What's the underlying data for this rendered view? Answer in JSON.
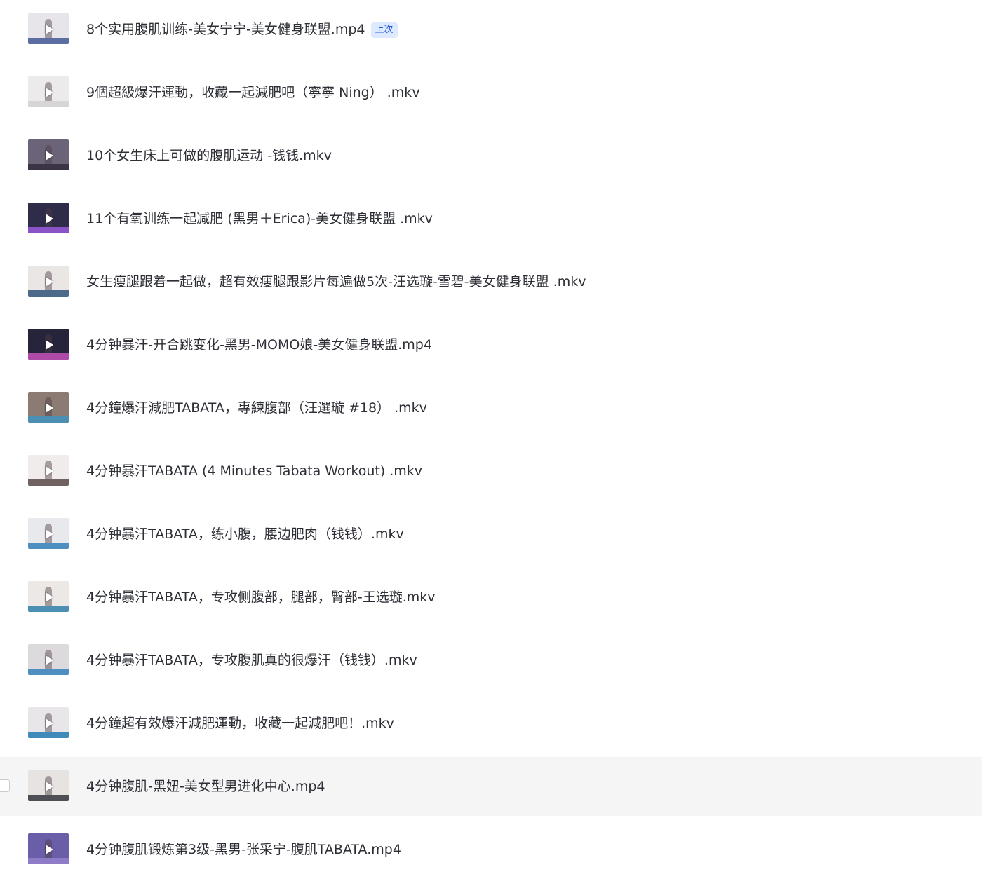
{
  "files": [
    {
      "name": "8个实用腹肌训练-美女宁宁-美女健身联盟.mp4",
      "badge": "上次",
      "thumb_bg": "#e7e4ea",
      "thumb_band": "#5b6da1"
    },
    {
      "name": "9個超級爆汗運動，收藏一起減肥吧（寧寧 Ning） .mkv",
      "badge": "",
      "thumb_bg": "#eceaea",
      "thumb_band": "#d8d5d6"
    },
    {
      "name": "10个女生床上可做的腹肌运动 -钱钱.mkv",
      "badge": "",
      "thumb_bg": "#6b6478",
      "thumb_band": "#3a3446"
    },
    {
      "name": "11个有氧训练一起减肥 (黑男＋Erica)-美女健身联盟 .mkv",
      "badge": "",
      "thumb_bg": "#2f2c4a",
      "thumb_band": "#8a54c8"
    },
    {
      "name": "女生瘦腿跟着一起做，超有效瘦腿跟影片每遍做5次-汪选璇-雪碧-美女健身联盟 .mkv",
      "badge": "",
      "thumb_bg": "#e9e6e4",
      "thumb_band": "#4d6a8a"
    },
    {
      "name": "4分钟暴汗-开合跳变化-黑男-MOMO娘-美女健身联盟.mp4",
      "badge": "",
      "thumb_bg": "#26243a",
      "thumb_band": "#b04aa8"
    },
    {
      "name": "4分鐘爆汗減肥TABATA，專練腹部（汪選璇 #18） .mkv",
      "badge": "",
      "thumb_bg": "#8b7b73",
      "thumb_band": "#4d8fb3"
    },
    {
      "name": "4分钟暴汗TABATA (4 Minutes Tabata Workout) .mkv",
      "badge": "",
      "thumb_bg": "#efeceb",
      "thumb_band": "#6f6260"
    },
    {
      "name": "4分钟暴汗TABATA，练小腹，腰边肥肉（钱钱）.mkv",
      "badge": "",
      "thumb_bg": "#e7e9ec",
      "thumb_band": "#4d8fc0"
    },
    {
      "name": "4分钟暴汗TABATA，专攻侧腹部，腿部，臀部-王选璇.mkv",
      "badge": "",
      "thumb_bg": "#ebe8e6",
      "thumb_band": "#4d8fb3"
    },
    {
      "name": "4分钟暴汗TABATA，专攻腹肌真的很爆汗（钱钱）.mkv",
      "badge": "",
      "thumb_bg": "#dcdadd",
      "thumb_band": "#4d8fc0"
    },
    {
      "name": "4分鐘超有效爆汗減肥運動，收藏一起減肥吧！.mkv",
      "badge": "",
      "thumb_bg": "#e8e6e9",
      "thumb_band": "#3f8ab8"
    },
    {
      "name": "4分钟腹肌-黑妞-美女型男进化中心.mp4",
      "badge": "",
      "thumb_bg": "#e6e3e1",
      "thumb_band": "#4d4f55"
    },
    {
      "name": "4分钟腹肌锻炼第3级-黑男-张采宁-腹肌TABATA.mp4",
      "badge": "",
      "thumb_bg": "#6a5ea8",
      "thumb_band": "#8e7cc8"
    }
  ]
}
